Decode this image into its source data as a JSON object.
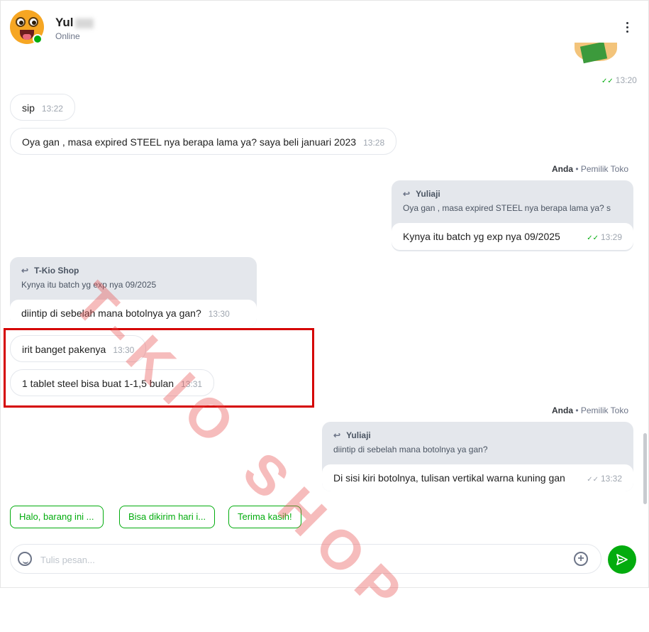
{
  "header": {
    "name": "Yul",
    "status": "Online"
  },
  "messages": {
    "sticker_time": "13:20",
    "m1": {
      "text": "sip",
      "time": "13:22"
    },
    "m2": {
      "text": "Oya gan , masa expired STEEL nya berapa lama ya? saya beli januari 2023",
      "time": "13:28"
    },
    "out1": {
      "sender": "Anda",
      "role": "Pemilik Toko",
      "reply_name": "Yuliaji",
      "reply_text": "Oya gan , masa expired STEEL nya berapa lama ya? s",
      "text": "Kynya itu batch yg exp nya 09/2025",
      "time": "13:29"
    },
    "in_reply": {
      "reply_name": "T-Kio Shop",
      "reply_text": "Kynya itu batch yg exp nya 09/2025",
      "text": "diintip di sebelah mana botolnya ya gan?",
      "time": "13:30"
    },
    "m3": {
      "text": "irit banget pakenya",
      "time": "13:30"
    },
    "m4": {
      "text": "1 tablet steel bisa buat 1-1,5 bulan",
      "time": "13:31"
    },
    "out2": {
      "sender": "Anda",
      "role": "Pemilik Toko",
      "reply_name": "Yuliaji",
      "reply_text": "diintip di sebelah mana botolnya ya gan?",
      "text": "Di sisi kiri botolnya, tulisan vertikal warna kuning gan",
      "time": "13:32"
    }
  },
  "quick_replies": [
    "Halo, barang ini ...",
    "Bisa dikirim hari i...",
    "Terima kasih!"
  ],
  "composer": {
    "placeholder": "Tulis pesan..."
  },
  "watermark": "T-KIO SHOP",
  "colors": {
    "accent": "#03ac0e",
    "highlight": "#d50000"
  },
  "icons": [
    "kebab-menu-icon",
    "reply-arrow-icon",
    "double-check-icon",
    "emoji-icon",
    "add-attachment-icon",
    "send-icon"
  ]
}
